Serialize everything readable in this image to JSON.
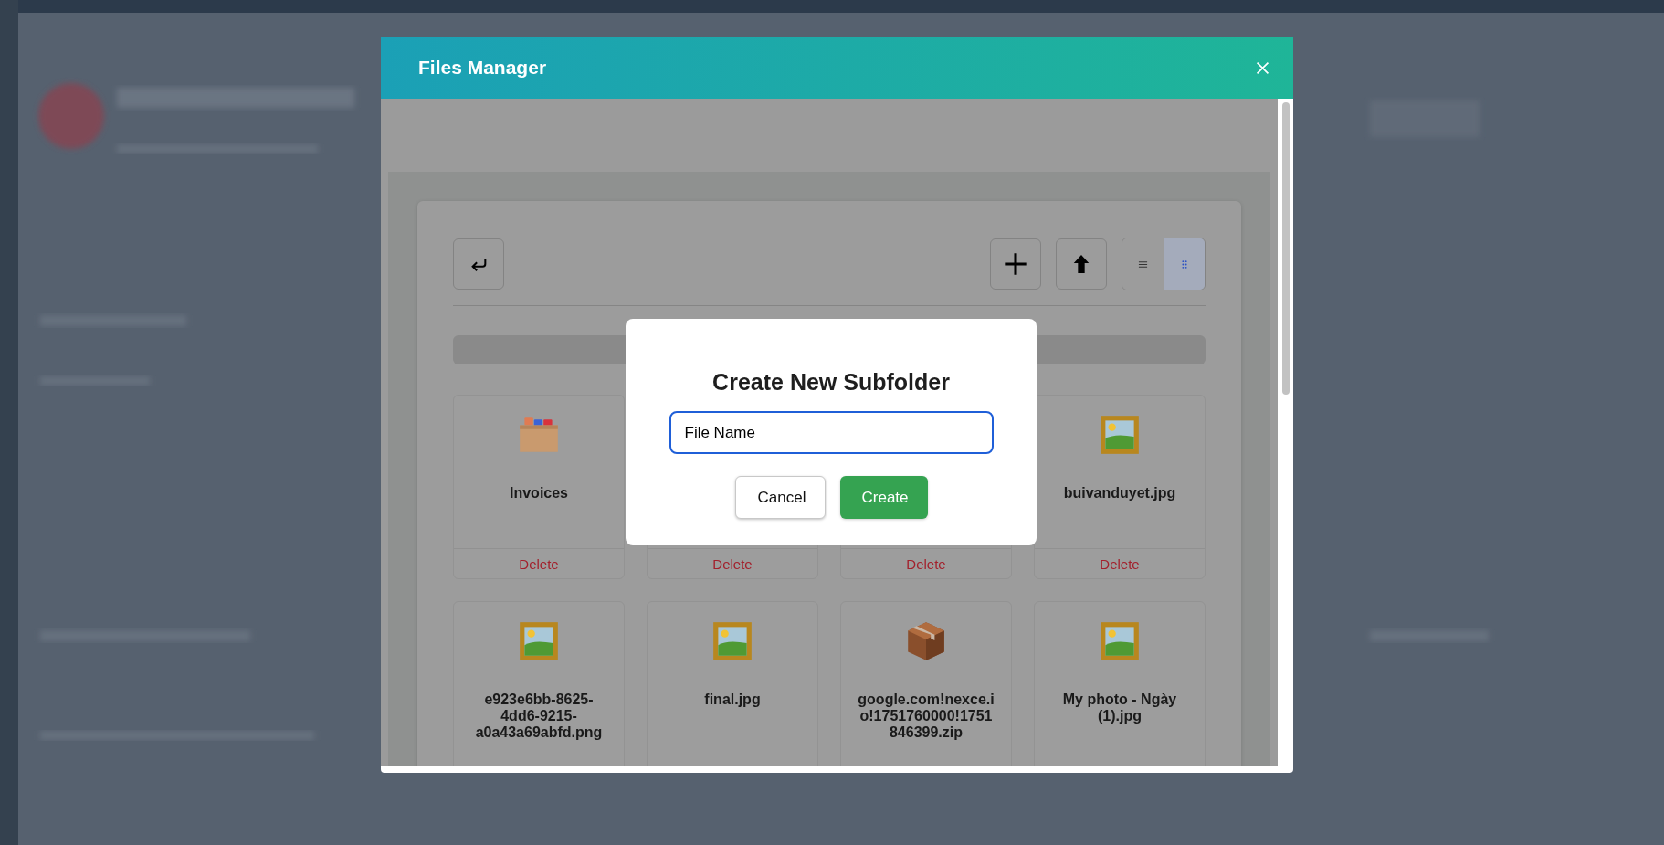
{
  "modal": {
    "title": "Files Manager"
  },
  "toolbar": {
    "view_modes": [
      {
        "kind": "list",
        "selected": false
      },
      {
        "kind": "grid",
        "selected": true
      }
    ]
  },
  "tiles": [
    {
      "kind": "folder",
      "name": "Invoices",
      "delete": "Delete"
    },
    {
      "delete": "Delete"
    },
    {
      "delete": "Delete"
    },
    {
      "kind": "image",
      "name": "buivanduyet.jpg",
      "delete": "Delete"
    },
    {
      "kind": "image",
      "name": "e923e6bb-8625-4dd6-9215-a0a43a69abfd.png"
    },
    {
      "kind": "image",
      "name": "final.jpg"
    },
    {
      "kind": "archive",
      "name": "google.com!nexce.io!1751760000!1751846399.zip"
    },
    {
      "kind": "image",
      "name": "My photo - Ngày (1).jpg"
    }
  ],
  "dialog": {
    "title": "Create New Subfolder",
    "field_value": "File Name",
    "buttons": [
      {
        "kind": "secondary",
        "label": "Cancel"
      },
      {
        "kind": "primary",
        "label": "Create"
      }
    ]
  }
}
